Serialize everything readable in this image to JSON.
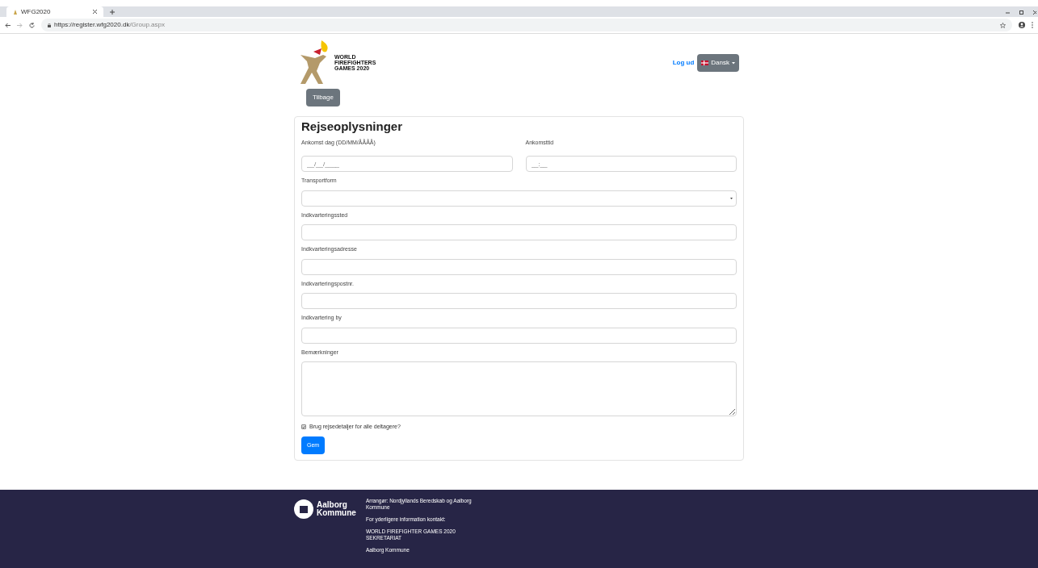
{
  "browser": {
    "tab_title": "WFG2020",
    "url_host": "https://register.wfg2020.dk",
    "url_path": "/Group.aspx"
  },
  "header": {
    "logo_lines": [
      "WORLD",
      "FIREFIGHTERS",
      "GAMES 2020"
    ],
    "logout": "Log ud",
    "language": "Dansk",
    "back_button": "Tilbage"
  },
  "form": {
    "title": "Rejseoplysninger",
    "arrival": [
      {
        "label": "Ankomst dag (DD/MM/ÅÅÅÅ)",
        "placeholder": "__/__/____"
      },
      {
        "label": "Ankomsttid",
        "placeholder": "__:__"
      }
    ],
    "fields": [
      {
        "label": "Transportform",
        "kind": "select"
      },
      {
        "label": "Indkvarteringssted",
        "kind": "text"
      },
      {
        "label": "Indkvarteringsadresse",
        "kind": "text"
      },
      {
        "label": "Indkvarteringspostnr.",
        "kind": "text"
      },
      {
        "label": "Indkvartering by",
        "kind": "text"
      },
      {
        "label": "Bemærkninger",
        "kind": "textarea"
      }
    ],
    "checkbox": {
      "label": "Brug rejsedetaljer for alle deltagere?",
      "checked": true
    },
    "save_button": "Gem"
  },
  "footer": {
    "logo_lines": [
      "Aalborg",
      "Kommune"
    ],
    "paragraphs": [
      "Arrangør: Nordjyllands Beredskab og Aalborg Kommune",
      "For yderligere information kontakt:",
      "WORLD FIREFIGHTER GAMES 2020 SEKRETARIAT",
      "Aalborg Kommune"
    ]
  }
}
